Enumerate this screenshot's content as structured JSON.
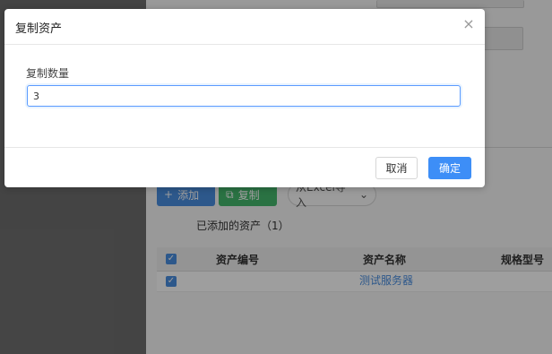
{
  "background": {
    "toolbar": {
      "add_label": "添加",
      "copy_label": "复制",
      "excel_label": "从Excel导入"
    },
    "tab_title": "已添加的资产（1）",
    "table": {
      "headers": [
        "资产编号",
        "资产名称",
        "规格型号"
      ],
      "rows": [
        {
          "asset_name": "测试服务器"
        }
      ]
    }
  },
  "dialog": {
    "title": "复制资产",
    "field_label": "复制数量",
    "quantity_value": "3",
    "cancel_label": "取消",
    "confirm_label": "确定"
  },
  "colors": {
    "primary": "#3d8ef7",
    "success": "#45b86d",
    "overlay": "rgba(0,0,0,0.38)"
  },
  "icons": {
    "close": "close-icon",
    "add": "plus-icon",
    "copy": "copy-icon",
    "excel_dropdown": "chevron-down-icon"
  }
}
